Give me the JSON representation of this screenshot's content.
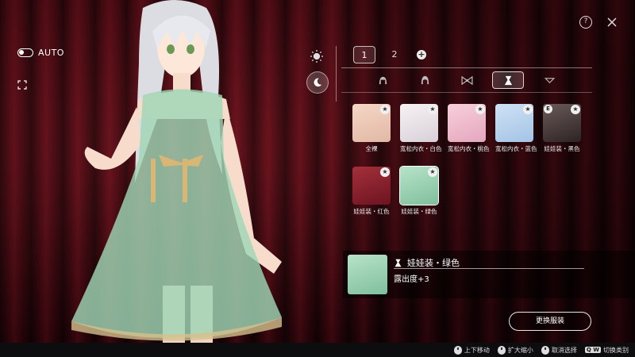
{
  "topbar": {
    "auto_label": "AUTO",
    "help_symbol": "?",
    "icons": [
      "fullscreen-icon",
      "help-icon",
      "close-icon"
    ]
  },
  "mode": {
    "icons": [
      "sun-icon",
      "moon-icon"
    ],
    "active": "moon"
  },
  "pages": {
    "tabs": [
      {
        "label": "1",
        "active": true
      },
      {
        "label": "2",
        "active": false
      }
    ],
    "add_symbol": "+"
  },
  "categories": {
    "icons": [
      "hair-icon",
      "hair-alt-icon",
      "ribbon-icon",
      "dress-icon",
      "chevron-icon"
    ],
    "active_index": 3
  },
  "outfits": [
    {
      "label": "全裸",
      "star": "★",
      "selected": false
    },
    {
      "label": "宽松内衣・白色",
      "star": "★",
      "selected": false
    },
    {
      "label": "宽松内衣・桃色",
      "star": "★",
      "selected": false
    },
    {
      "label": "宽松内衣・蓝色",
      "star": "★",
      "selected": false
    },
    {
      "label": "娃娃装・黑色",
      "star": "★",
      "badge": "E",
      "selected": false
    },
    {
      "label": "娃娃装・红色",
      "star": "★",
      "selected": false
    },
    {
      "label": "娃娃装・绿色",
      "star": "★",
      "selected": true
    }
  ],
  "detail": {
    "title": "娃娃装・绿色",
    "description": "露出度+3"
  },
  "change_button_label": "更换服装",
  "footer": {
    "hints": [
      {
        "key": "mouse",
        "label": "上下移动"
      },
      {
        "key": "mouse",
        "label": "扩大缩小"
      },
      {
        "key": "mouse",
        "label": "取消选择"
      },
      {
        "key": "Q W",
        "label": "切换类别"
      }
    ]
  },
  "colors": {
    "curtain": "#4a0a13",
    "dress": "#9fd6b4",
    "panel_overlay": "#000000"
  }
}
